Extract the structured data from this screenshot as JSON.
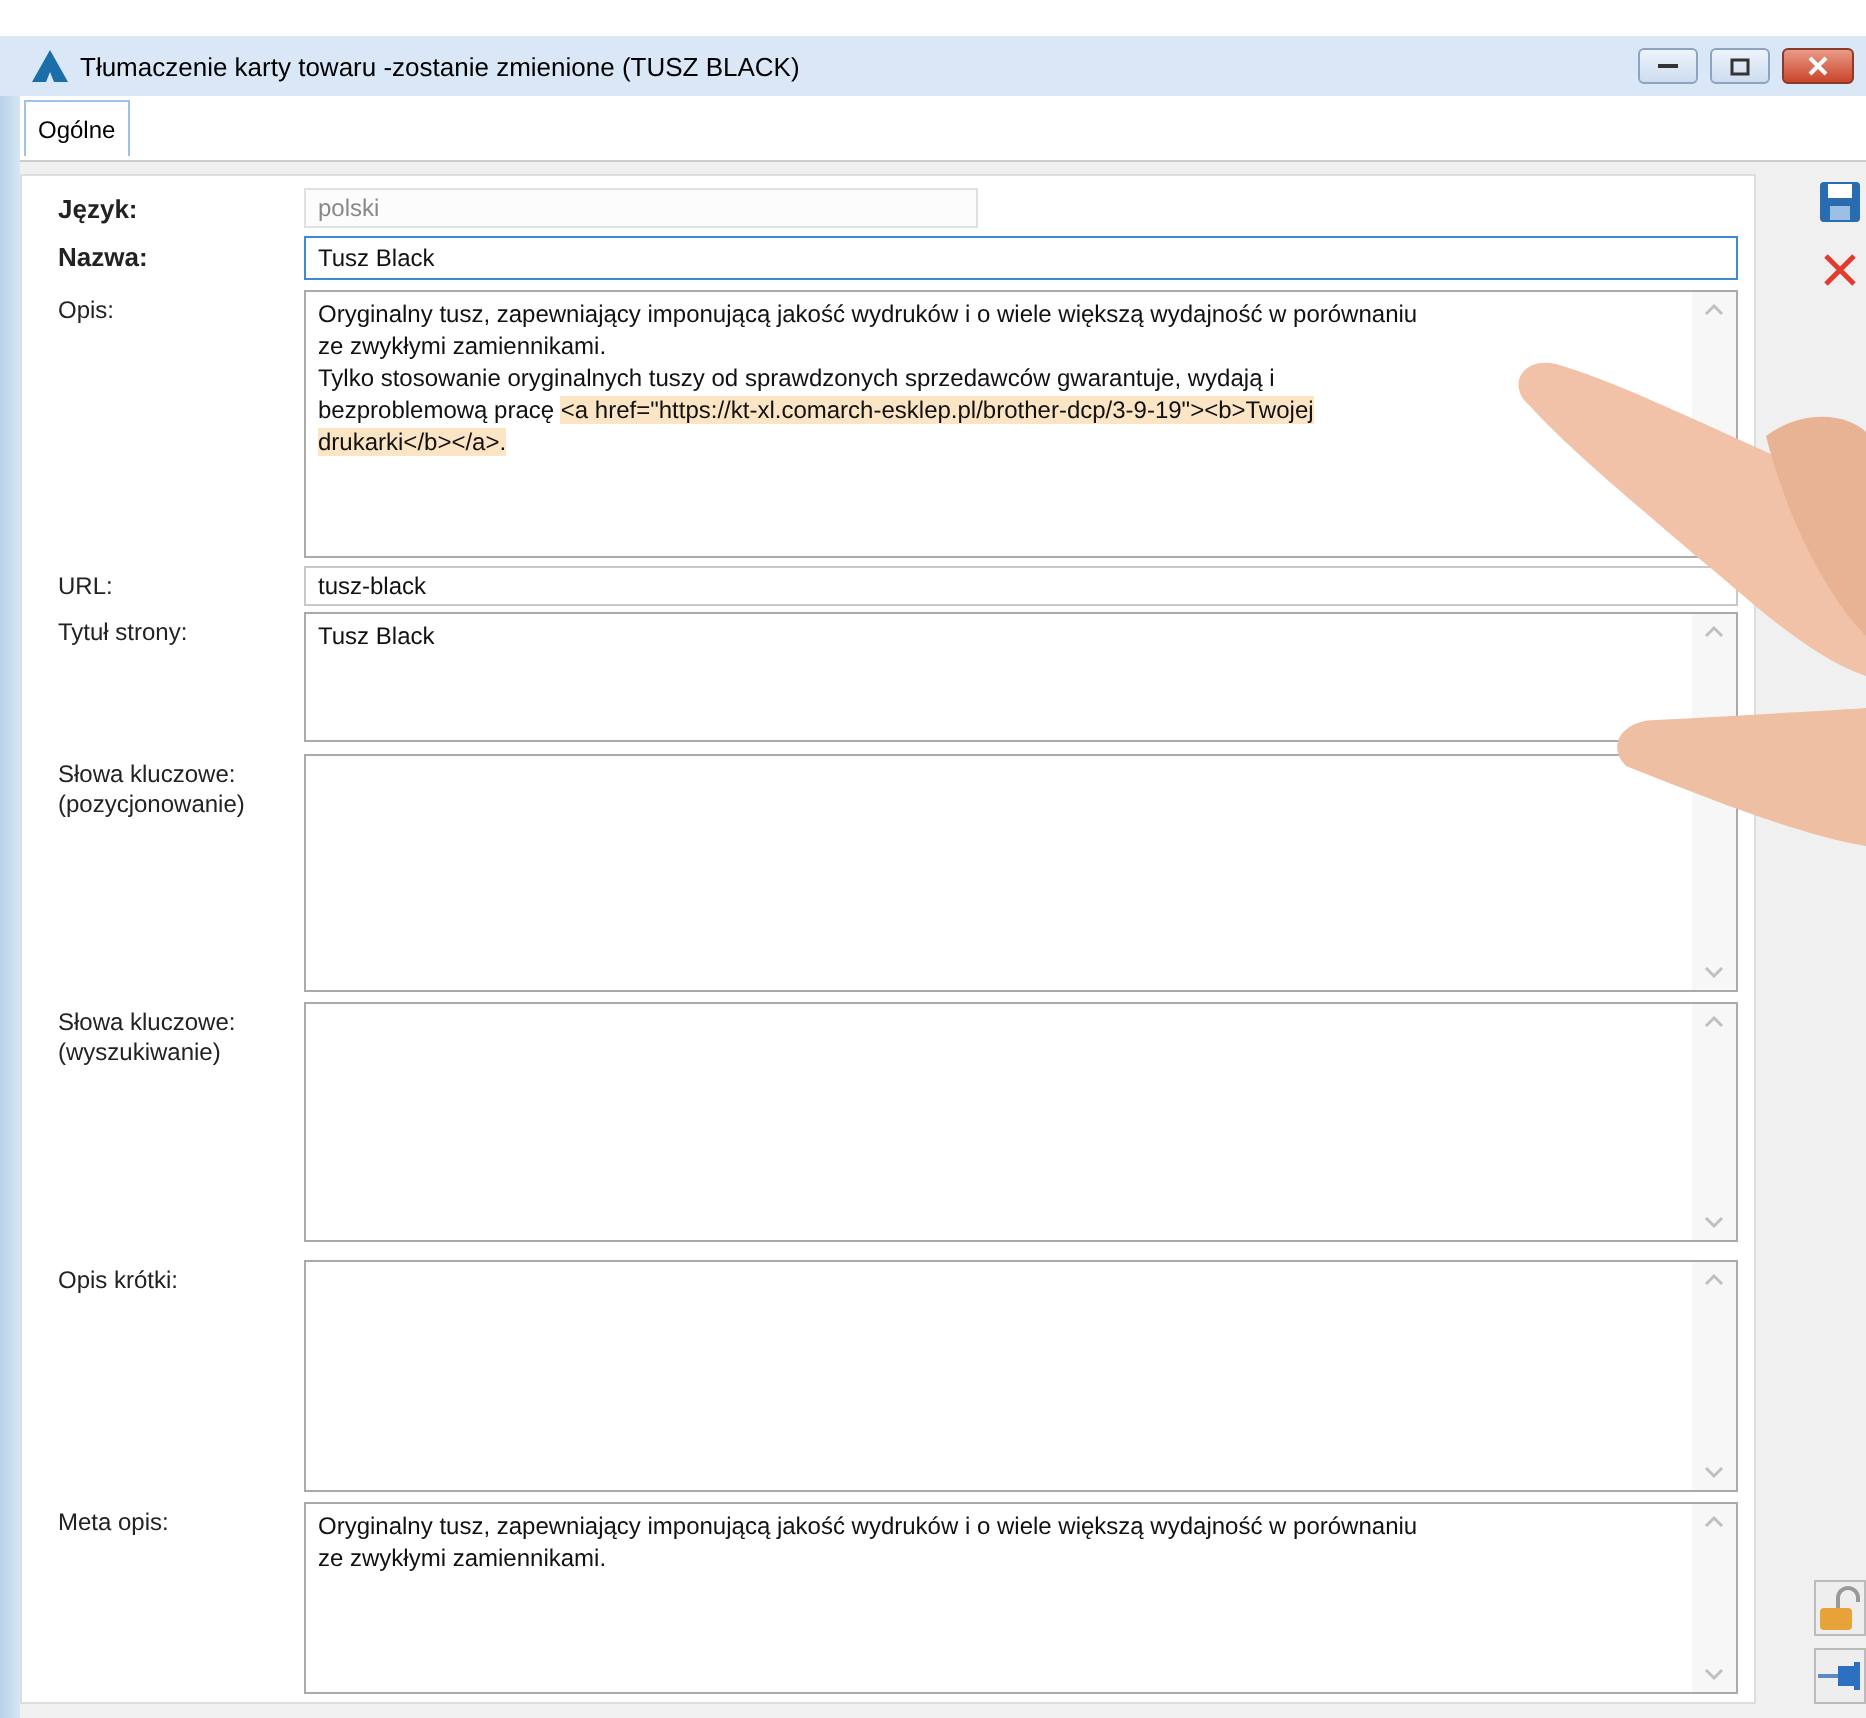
{
  "window": {
    "title": "Tłumaczenie karty towaru -zostanie zmienione (TUSZ BLACK)"
  },
  "tabs": [
    {
      "label": "Ogólne",
      "selected": true
    }
  ],
  "fields": [
    {
      "kind": "input",
      "label": "Język:",
      "bold": true,
      "disabled": true,
      "focused": false,
      "value": [
        {
          "text": "polski",
          "highlighted": false
        }
      ]
    },
    {
      "kind": "input",
      "label": "Nazwa:",
      "bold": true,
      "disabled": false,
      "focused": true,
      "value": [
        {
          "text": "Tusz Black",
          "highlighted": false
        }
      ]
    },
    {
      "kind": "textarea",
      "label": "Opis:",
      "bold": false,
      "disabled": false,
      "focused": false,
      "value": [
        {
          "text": "Oryginalny tusz, zapewniający imponującą jakość wydruków i o wiele większą wydajność w porównaniu\nze zwykłymi zamiennikami.\nTylko stosowanie oryginalnych tuszy od sprawdzonych sprzedawców gwarantuje, wydają i\nbezproblemową pracę ",
          "highlighted": false
        },
        {
          "text": "<a href=\"https://kt-xl.comarch-esklep.pl/brother-dcp/3-9-19\"><b>Twojej\ndrukarki</b></a>.",
          "highlighted": true
        }
      ]
    },
    {
      "kind": "input",
      "label": "URL:",
      "bold": false,
      "disabled": false,
      "focused": false,
      "value": [
        {
          "text": "tusz-black",
          "highlighted": false
        }
      ]
    },
    {
      "kind": "textarea",
      "label": "Tytuł strony:",
      "bold": false,
      "disabled": false,
      "focused": false,
      "value": [
        {
          "text": "Tusz Black",
          "highlighted": false
        }
      ]
    },
    {
      "kind": "textarea",
      "label": "Słowa kluczowe:\n(pozycjonowanie)",
      "bold": false,
      "disabled": false,
      "focused": false
    },
    {
      "kind": "textarea",
      "label": "Słowa kluczowe:\n(wyszukiwanie)",
      "bold": false,
      "disabled": false,
      "focused": false
    },
    {
      "kind": "textarea",
      "label": "Opis krótki:",
      "bold": false,
      "disabled": false,
      "focused": false
    },
    {
      "kind": "textarea",
      "label": "Meta opis:",
      "bold": false,
      "disabled": false,
      "focused": false,
      "value": [
        {
          "text": "Oryginalny tusz, zapewniający imponującą jakość wydruków i o wiele większą wydajność w porównaniu\nze zwykłymi zamiennikami.",
          "highlighted": false
        }
      ]
    }
  ]
}
